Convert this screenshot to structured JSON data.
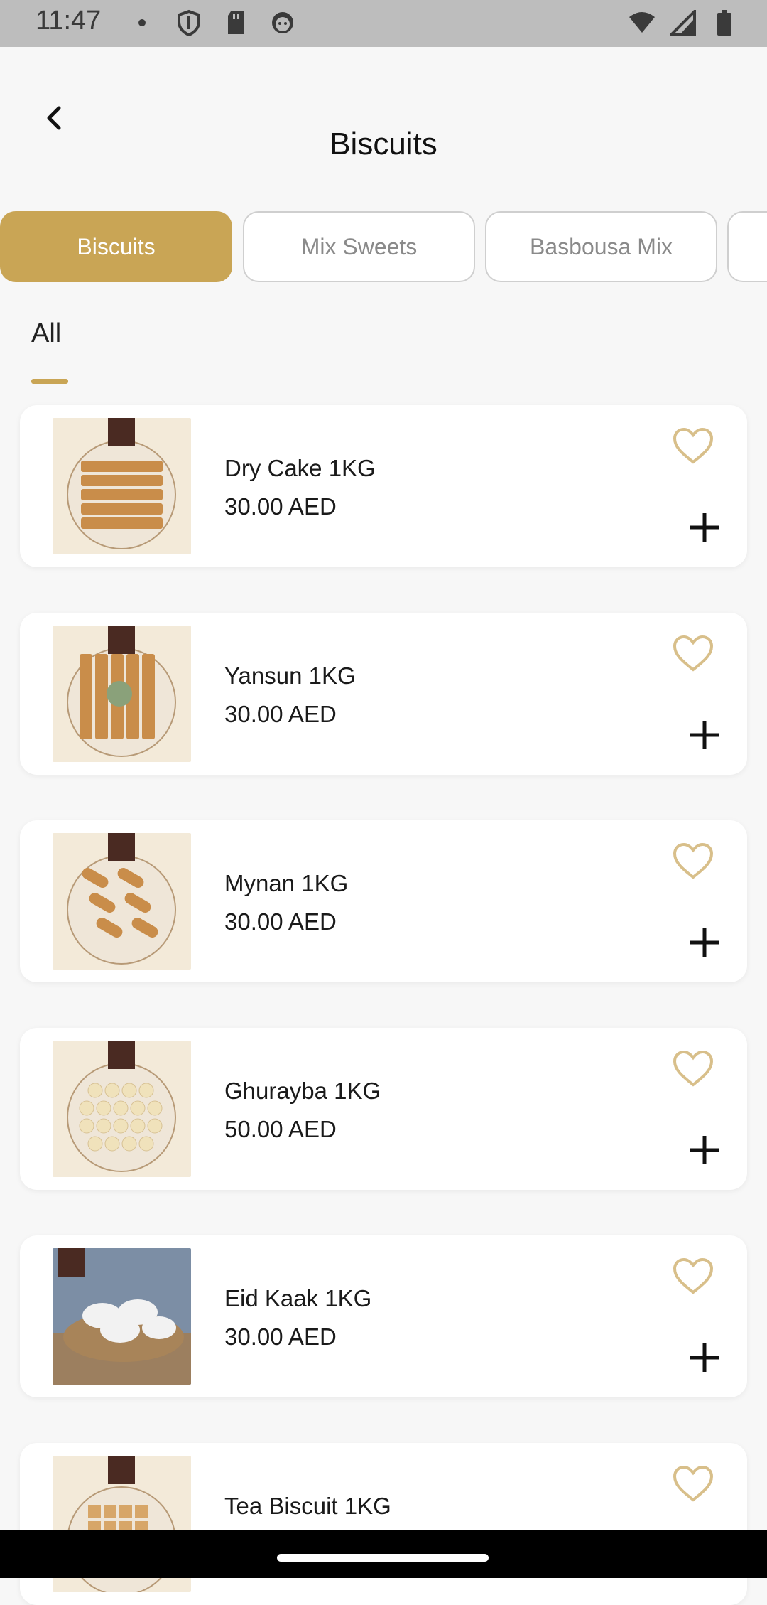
{
  "status_bar": {
    "time": "11:47"
  },
  "header": {
    "title": "Biscuits"
  },
  "categories": [
    {
      "label": "Biscuits",
      "active": true
    },
    {
      "label": "Mix Sweets",
      "active": false
    },
    {
      "label": "Basbousa Mix",
      "active": false
    },
    {
      "label": "",
      "active": false
    }
  ],
  "tabs": [
    {
      "label": "All",
      "active": true
    }
  ],
  "products": [
    {
      "name": "Dry Cake 1KG",
      "price": "30.00 AED"
    },
    {
      "name": "Yansun 1KG",
      "price": "30.00 AED"
    },
    {
      "name": "Mynan 1KG",
      "price": "30.00 AED"
    },
    {
      "name": "Ghurayba 1KG",
      "price": "50.00 AED"
    },
    {
      "name": "Eid Kaak 1KG",
      "price": "30.00 AED"
    },
    {
      "name": "Tea Biscuit 1KG",
      "price": ""
    }
  ],
  "colors": {
    "accent": "#c9a555",
    "background": "#f7f7f7"
  }
}
